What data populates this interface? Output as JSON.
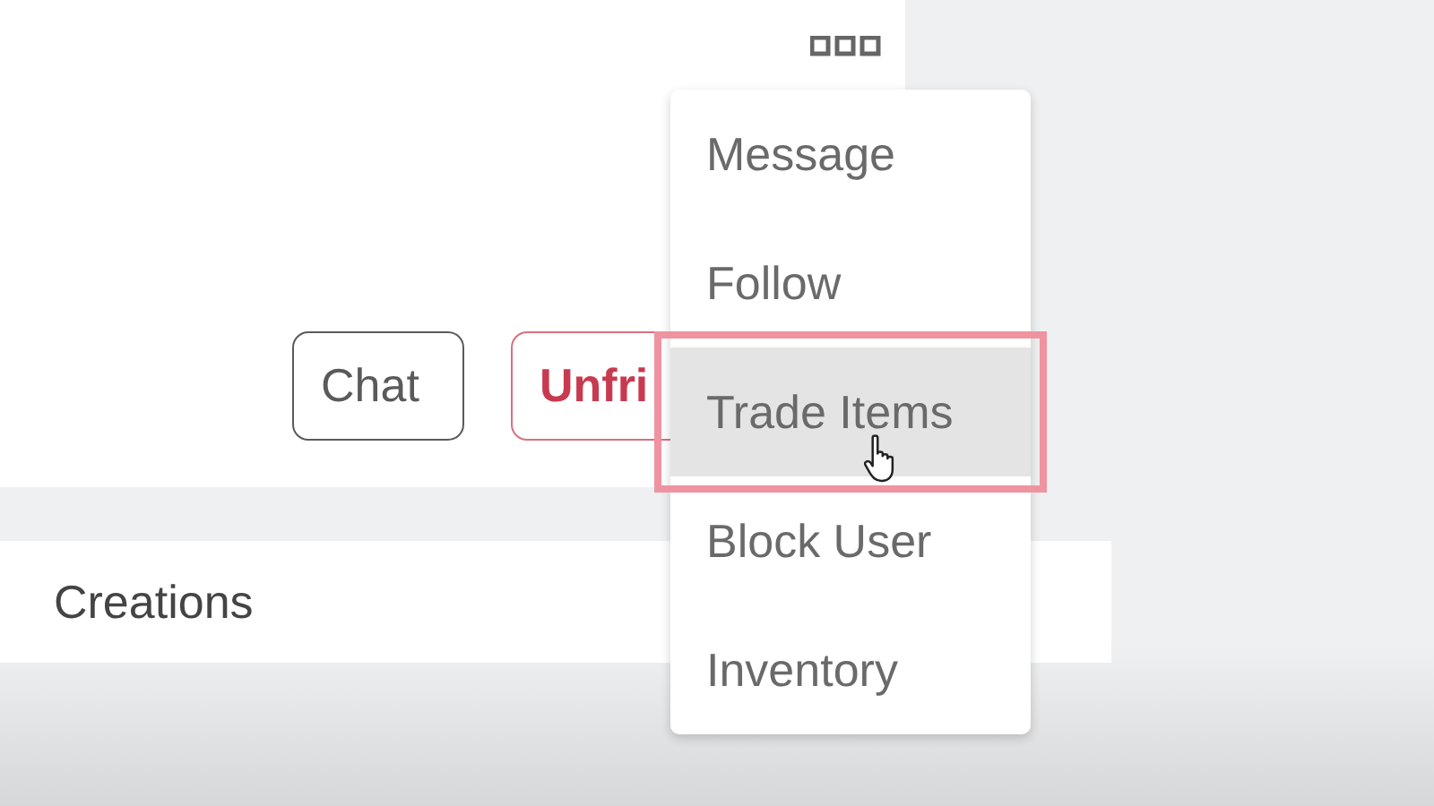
{
  "profile_buttons": [
    {
      "label": "Chat",
      "kind": "neutral"
    },
    {
      "label": "Unfri",
      "kind": "danger"
    }
  ],
  "menu": {
    "items": [
      {
        "label": "Message",
        "selected": false
      },
      {
        "label": "Follow",
        "selected": false
      },
      {
        "label": "Trade Items",
        "selected": true
      },
      {
        "label": "Block User",
        "selected": false
      },
      {
        "label": "Inventory",
        "selected": false
      }
    ]
  },
  "section": {
    "title": "Creations"
  }
}
